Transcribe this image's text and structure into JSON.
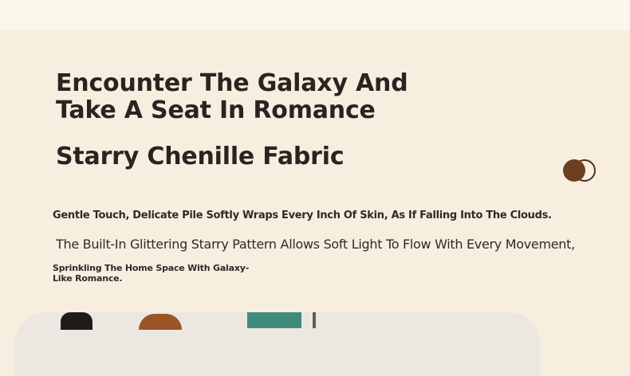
{
  "hero": {
    "headline": "Encounter The Galaxy And Take A Seat In Romance",
    "subhead": "Starry Chenille Fabric",
    "para1": "Gentle Touch, Delicate Pile Softly Wraps Every Inch Of Skin, As If Falling Into The Clouds.",
    "para2": "The Built-In Glittering Starry Pattern Allows Soft Light To Flow With Every Movement,",
    "para3": "Sprinkling The Home Space With Galaxy-Like Romance."
  },
  "colors": {
    "background": "#f8eee0",
    "top_band": "#fcf7eb",
    "text": "#2a2421",
    "swatch_selected": "#6b3f1f",
    "swatch_outline": "#4a3222"
  },
  "swatches": [
    {
      "name": "dark-brown",
      "selected": true
    },
    {
      "name": "cream",
      "selected": false
    }
  ]
}
